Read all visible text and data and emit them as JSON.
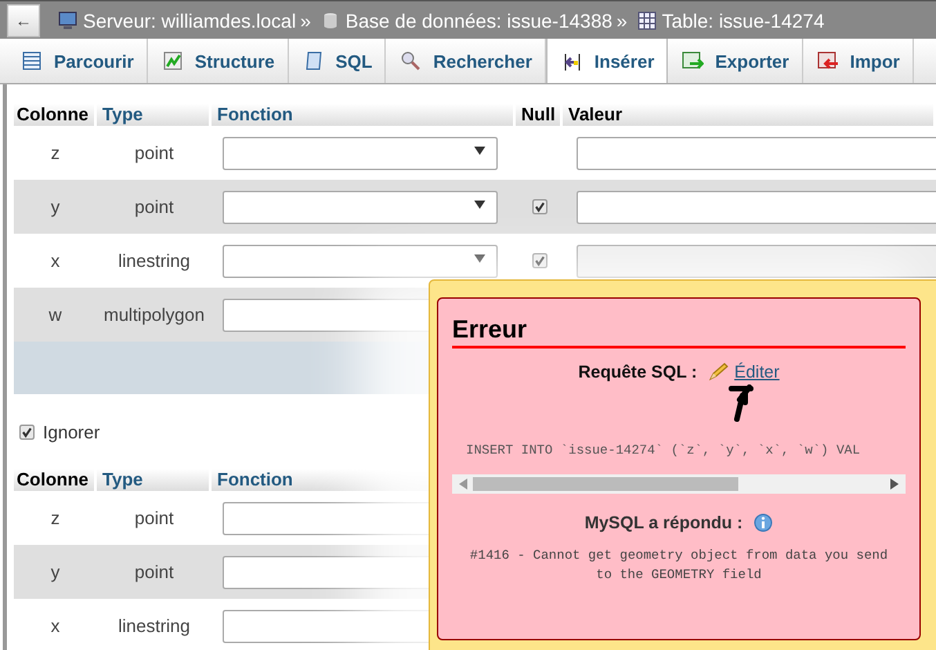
{
  "breadcrumb": [
    {
      "kind": "server",
      "text": "Serveur: williamdes.local"
    },
    {
      "kind": "database",
      "text": "Base de données: issue-14388"
    },
    {
      "kind": "table",
      "text": "Table: issue-14274"
    }
  ],
  "separator": "»",
  "back_button": "←",
  "tabs": [
    {
      "kind": "browse",
      "label": "Parcourir",
      "selected": false
    },
    {
      "kind": "structure",
      "label": "Structure",
      "selected": false
    },
    {
      "kind": "sql",
      "label": "SQL",
      "selected": false
    },
    {
      "kind": "search",
      "label": "Rechercher",
      "selected": false
    },
    {
      "kind": "insert",
      "label": "Insérer",
      "selected": true
    },
    {
      "kind": "export",
      "label": "Exporter",
      "selected": false
    },
    {
      "kind": "import",
      "label": "Impor",
      "selected": false
    }
  ],
  "tables": [
    {
      "columns": [
        "Colonne",
        "Type",
        "Fonction",
        "Null",
        "Valeur"
      ],
      "rows": [
        {
          "column": "z",
          "type": "point"
        },
        {
          "column": "y",
          "type": "point",
          "checked": true
        },
        {
          "column": "x",
          "type": "linestring",
          "checked": true,
          "value_disabled": true
        },
        {
          "column": "w",
          "type": "multipolygon"
        }
      ],
      "footer": true
    },
    {
      "columns": [
        "Colonne",
        "Type",
        "Fonction"
      ],
      "rows": [
        {
          "column": "z",
          "type": "point"
        },
        {
          "column": "y",
          "type": "point"
        },
        {
          "column": "x",
          "type": "linestring"
        }
      ]
    }
  ],
  "ignore": {
    "label": "Ignorer",
    "checked": true
  },
  "error": {
    "title": "Erreur",
    "query_label": "Requête SQL :",
    "edit_link": "Éditer",
    "query": "INSERT INTO `issue-14274` (`z`, `y`, `x`, `w`) VAL",
    "response_label": "MySQL a répondu :",
    "message": "#1416 - Cannot get geometry object from data you send to the GEOMETRY field"
  }
}
